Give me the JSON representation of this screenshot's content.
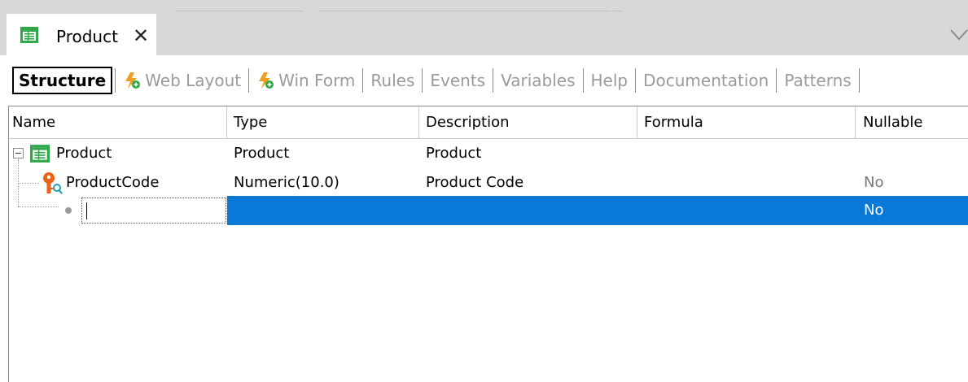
{
  "document_tab": {
    "title": "Product",
    "close_glyph": "✕",
    "icon": "transaction-icon"
  },
  "subtabs": [
    {
      "label": "Structure",
      "active": true
    },
    {
      "label": "Web Layout",
      "icon": "lightning-plus-icon"
    },
    {
      "label": "Win Form",
      "icon": "lightning-plus-icon"
    },
    {
      "label": "Rules"
    },
    {
      "label": "Events"
    },
    {
      "label": "Variables"
    },
    {
      "label": "Help"
    },
    {
      "label": "Documentation"
    },
    {
      "label": "Patterns"
    }
  ],
  "grid": {
    "columns": [
      "Name",
      "Type",
      "Description",
      "Formula",
      "Nullable"
    ],
    "rows": [
      {
        "name": "Product",
        "type": "Product",
        "description": "Product",
        "formula": "",
        "nullable": "",
        "icon": "transaction-icon"
      },
      {
        "name": "ProductCode",
        "type": "Numeric(10.0)",
        "description": "Product Code",
        "formula": "",
        "nullable": "No",
        "icon": "key-icon"
      },
      {
        "name": "",
        "type": "",
        "description": "",
        "formula": "",
        "nullable": "No",
        "editing": true
      }
    ]
  },
  "colors": {
    "selection": "#0a78d7",
    "tab_strip": "#d8d8d8",
    "lightning": "#f0a020",
    "key": "#e8621a",
    "transaction": "#2ea84a"
  }
}
